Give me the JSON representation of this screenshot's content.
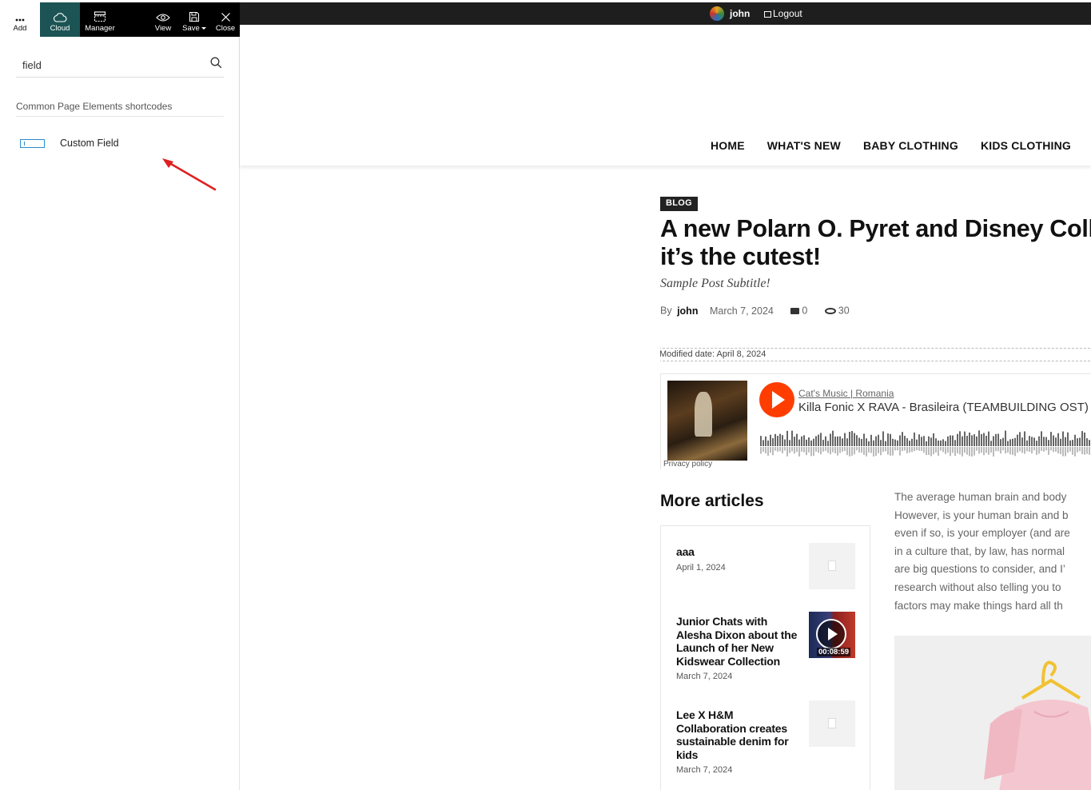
{
  "toolbar": {
    "add_label": "Add",
    "cloud_label": "Cloud",
    "manager_label": "Manager",
    "view_label": "View",
    "save_label": "Save",
    "close_label": "Close"
  },
  "panel": {
    "search_value": "field",
    "section_label": "Common Page Elements shortcodes",
    "custom_field_label": "Custom Field"
  },
  "adminbar": {
    "user_name": "john",
    "logout_label": "Logout"
  },
  "nav": {
    "items": [
      "HOME",
      "WHAT'S NEW",
      "BABY CLOTHING",
      "KIDS CLOTHING"
    ]
  },
  "article": {
    "category": "BLOG",
    "title_line1": "A new Polarn O. Pyret and Disney Colle",
    "title_line2": "it’s the cutest!",
    "subtitle": "Sample Post Subtitle!",
    "by_label": "By",
    "author": "john",
    "date": "March 7, 2024",
    "comments": "0",
    "views": "30",
    "modified": "Modified date: April 8, 2024"
  },
  "audio": {
    "artist": "Cat's Music | Romania",
    "track": "Killa Fonic X RAVA - Brasileira (TEAMBUILDING OST)",
    "privacy": "Privacy policy"
  },
  "more_articles": {
    "title": "More articles",
    "items": [
      {
        "title": "aaa",
        "date": "April 1, 2024"
      },
      {
        "title": "Junior Chats with Alesha Dixon about the Launch of her New Kidswear Collection",
        "date": "March 7, 2024",
        "duration": "00:08:59"
      },
      {
        "title": "Lee X H&M Collaboration creates sustainable denim for kids",
        "date": "March 7, 2024"
      }
    ]
  },
  "body_text": [
    "The average human brain and body",
    "However, is your human brain and b",
    "even if so, is your employer (and are",
    "in a culture that, by law, has normal",
    "are big questions to consider, and I’",
    "research without also telling you to",
    "factors may make things hard all th"
  ],
  "colors": {
    "toolbar_bg": "#000000",
    "cloud_active": "#1c5455",
    "play_accent": "#ff3d00",
    "arrow_red": "#e02020"
  }
}
